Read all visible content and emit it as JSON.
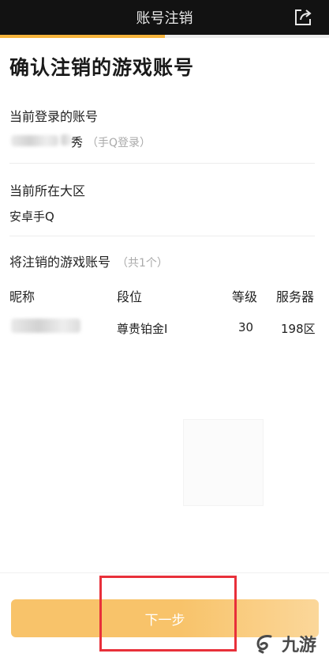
{
  "header": {
    "title": "账号注销",
    "progress_fraction": 0.5
  },
  "page": {
    "title": "确认注销的游戏账号"
  },
  "current_account": {
    "label": "当前登录的账号",
    "suffix_char": "秀",
    "login_type": "（手Q登录）"
  },
  "current_region": {
    "label": "当前所在大区",
    "value": "安卓手Q"
  },
  "accounts_to_cancel": {
    "label": "将注销的游戏账号",
    "count_text": "（共1个）",
    "columns": [
      "昵称",
      "段位",
      "等级",
      "服务器"
    ],
    "rows": [
      {
        "nickname": "",
        "rank": "尊贵铂金I",
        "level": "30",
        "server": "198区"
      }
    ]
  },
  "footer": {
    "next_label": "下一步"
  },
  "watermark": {
    "text": "九游"
  },
  "colors": {
    "accent": "#f6b43c",
    "button": "#f8c36a",
    "highlight": "#e8303a",
    "header_bg": "#121212"
  }
}
